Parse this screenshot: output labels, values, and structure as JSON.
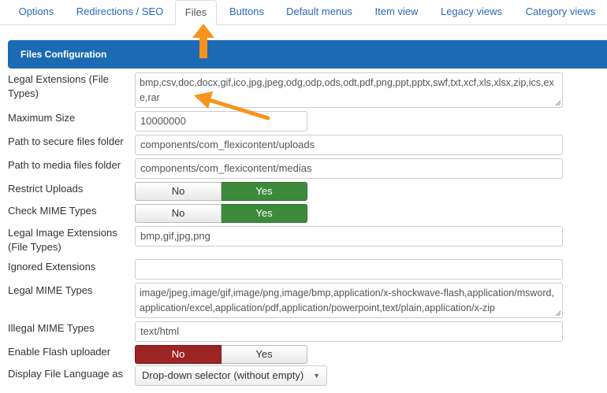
{
  "tabs": [
    {
      "label": "Options"
    },
    {
      "label": "Redirections / SEO"
    },
    {
      "label": "Files"
    },
    {
      "label": "Buttons"
    },
    {
      "label": "Default menus"
    },
    {
      "label": "Item view"
    },
    {
      "label": "Legacy views"
    },
    {
      "label": "Category views"
    }
  ],
  "panel": {
    "title": "Files Configuration"
  },
  "fields": {
    "legal_extensions": {
      "label": "Legal Extensions (File Types)",
      "value": "bmp,csv,doc,docx,gif,ico,jpg,jpeg,odg,odp,ods,odt,pdf,png,ppt,pptx,swf,txt,xcf,xls,xlsx,zip,ics,exe,rar"
    },
    "maximum_size": {
      "label": "Maximum Size",
      "value": "10000000"
    },
    "secure_path": {
      "label": "Path to secure files folder",
      "value": "components/com_flexicontent/uploads"
    },
    "media_path": {
      "label": "Path to media files folder",
      "value": "components/com_flexicontent/medias"
    },
    "restrict_uploads": {
      "label": "Restrict Uploads",
      "no": "No",
      "yes": "Yes",
      "selected": "Yes"
    },
    "check_mime": {
      "label": "Check MIME Types",
      "no": "No",
      "yes": "Yes",
      "selected": "Yes"
    },
    "image_extensions": {
      "label": "Legal Image Extensions (File Types)",
      "value": "bmp,gif,jpg,png"
    },
    "ignored_extensions": {
      "label": "Ignored Extensions",
      "value": ""
    },
    "legal_mime": {
      "label": "Legal MIME Types",
      "value": "image/jpeg,image/gif,image/png,image/bmp,application/x-shockwave-flash,application/msword,application/excel,application/pdf,application/powerpoint,text/plain,application/x-zip"
    },
    "illegal_mime": {
      "label": "Illegal MIME Types",
      "value": "text/html"
    },
    "flash_uploader": {
      "label": "Enable Flash uploader",
      "no": "No",
      "yes": "Yes",
      "selected": "No"
    },
    "file_language": {
      "label": "Display File Language as",
      "value": "Drop-down selector (without empty)"
    }
  },
  "colors": {
    "header_blue": "#1c6ab4",
    "yes_green": "#3d8a3d",
    "no_red": "#9c2424",
    "annotation_orange": "#f7941d",
    "link_blue": "#2a69b8"
  }
}
